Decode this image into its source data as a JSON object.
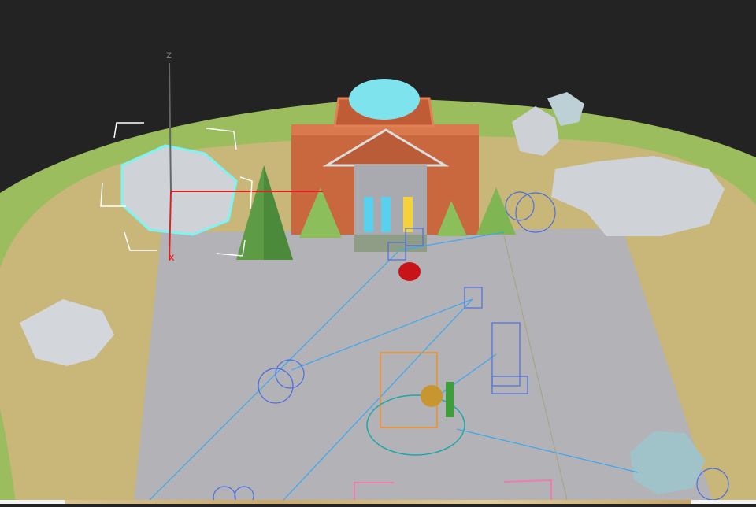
{
  "viewport": {
    "gizmo": {
      "z_label": "z",
      "x_label": "x"
    },
    "colors": {
      "background": "#232323",
      "grass": "#9dbf5f",
      "sand": "#c9b77a",
      "plaza": "#b4b3b8",
      "building": "#c9683f",
      "dome": "#7fe3ee",
      "selection": "#7ef4f2",
      "wireframe": "#4a6fe0",
      "light_line": "#3aa8f0"
    }
  }
}
